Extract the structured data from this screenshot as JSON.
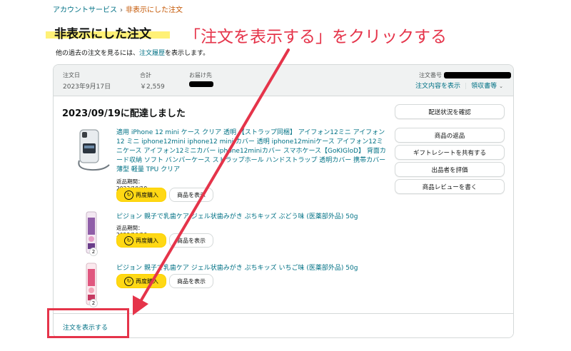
{
  "breadcrumb": {
    "parent": "アカウントサービス",
    "separator": "›",
    "current": "非表示にした注文"
  },
  "page": {
    "title": "非表示にした注文",
    "subtext_before": "他の過去の注文を見るには、",
    "subtext_link": "注文履歴",
    "subtext_after": "を表示します。"
  },
  "annotation": {
    "text": "「注文を表示する」をクリックする",
    "color": "#e5344a"
  },
  "order": {
    "date_label": "注文日",
    "date_value": "2023年9月17日",
    "total_label": "合計",
    "total_value": "￥2,559",
    "ship_label": "お届け先",
    "number_label": "注文番号",
    "details_link": "注文内容を表示",
    "receipt_link": "領収書等",
    "delivery_status": "2023/09/19に配達しました",
    "show_order_link": "注文を表示する"
  },
  "products": [
    {
      "title": "適用 iPhone 12 mini ケース クリア 透明 【ストラップ同梱】 アイフォン12ミニ アイフォン12 ミニ iphone12mini iphone12 mini カバー 透明 iphone12miniケース アイフォン12ミニケース アイフォン12ミニカバー iphone12miniカバー スマホケース【GoKIGloD】 背面カード収納 ソフト バンパーケース ストラップホール ハンドストラップ 透明カバー 携帯カバー 薄型 軽量 TPU クリア",
      "return": "返品期間：2023/10/19まで",
      "rebuy": "再度購入",
      "view": "商品を表示"
    },
    {
      "title": "ピジョン 親子で乳歯ケア ジェル状歯みがき ぷちキッズ ぶどう味 (医薬部外品) 50g",
      "return": "返品期間：2023/10/19まで",
      "rebuy": "再度購入",
      "view": "商品を表示",
      "qty": "2"
    },
    {
      "title": "ピジョン 親子で乳歯ケア ジェル状歯みがき ぷちキッズ いちご味 (医薬部外品) 50g",
      "rebuy": "再度購入",
      "view": "商品を表示",
      "qty": "2"
    }
  ],
  "actions": {
    "track": "配送状況を確認",
    "return": "商品の返品",
    "gift": "ギフトレシートを共有する",
    "rate_seller": "出品者を評価",
    "review": "商品レビューを書く"
  },
  "colors": {
    "link": "#007185",
    "buy_button": "#ffd814",
    "annotation_red": "#e5344a",
    "highlight": "#fff176"
  }
}
